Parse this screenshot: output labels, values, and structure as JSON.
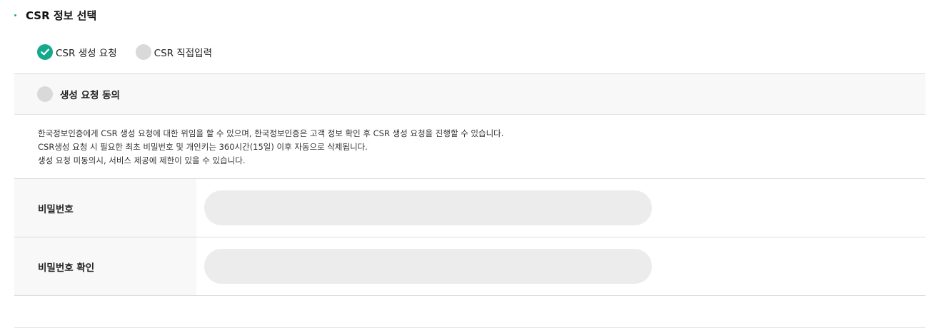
{
  "section": {
    "title": "CSR 정보 선택"
  },
  "csr_mode": {
    "options": [
      {
        "label": "CSR 생성 요청",
        "selected": true
      },
      {
        "label": "CSR 직접입력",
        "selected": false
      }
    ]
  },
  "agreement": {
    "label": "생성 요청 동의",
    "checked": false
  },
  "notice": {
    "lines": [
      "한국정보인증에게 CSR 생성 요청에 대한 위임을 할 수 있으며, 한국정보인증은 고객 정보 확인 후 CSR 생성 요청을 진행할 수 있습니다.",
      "CSR생성 요청 시 필요한 최초 비밀번호 및 개인키는 360시간(15일) 이후 자동으로 삭제됩니다.",
      "생성 요청 미동의시, 서비스 제공에 제한이 있을 수 있습니다."
    ]
  },
  "form": {
    "password": {
      "label": "비밀번호",
      "value": ""
    },
    "password_confirm": {
      "label": "비밀번호 확인",
      "value": ""
    }
  },
  "colors": {
    "accent": "#13a98a",
    "radio_off": "#d9d9d9",
    "input_bg": "#ececec",
    "header_bg": "#f8f8f8"
  }
}
